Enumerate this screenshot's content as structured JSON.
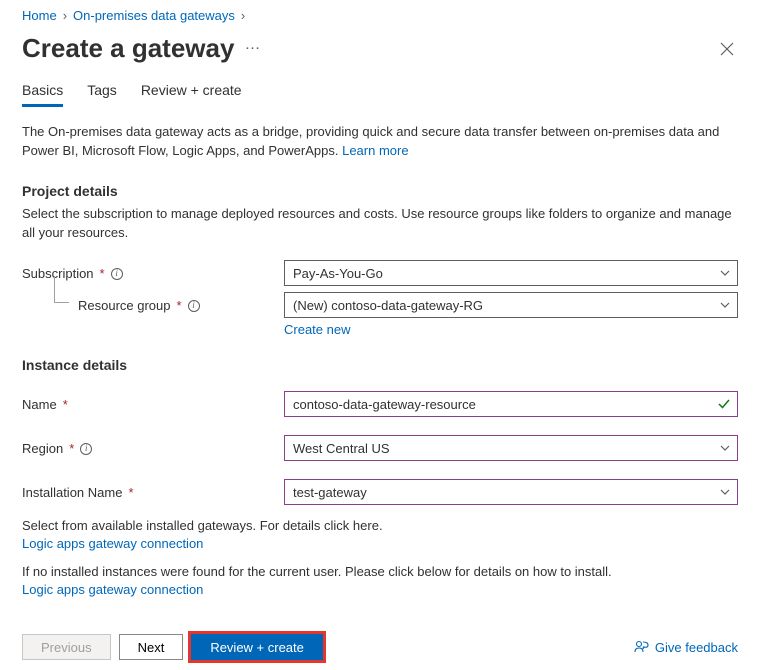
{
  "breadcrumb": {
    "home": "Home",
    "gateways": "On-premises data gateways"
  },
  "title": "Create a gateway",
  "tabs": {
    "basics": "Basics",
    "tags": "Tags",
    "review": "Review + create"
  },
  "description_text": "The On-premises data gateway acts as a bridge, providing quick and secure data transfer between on-premises data and Power BI, Microsoft Flow, Logic Apps, and PowerApps. ",
  "learn_more": "Learn more",
  "project_details": {
    "heading": "Project details",
    "desc": "Select the subscription to manage deployed resources and costs. Use resource groups like folders to organize and manage all your resources.",
    "subscription_label": "Subscription",
    "subscription_value": "Pay-As-You-Go",
    "rg_label": "Resource group",
    "rg_value": "(New) contoso-data-gateway-RG",
    "create_new": "Create new"
  },
  "instance_details": {
    "heading": "Instance details",
    "name_label": "Name",
    "name_value": "contoso-data-gateway-resource",
    "region_label": "Region",
    "region_value": "West Central US",
    "install_label": "Installation Name",
    "install_value": "test-gateway",
    "note1": "Select from available installed gateways. For details click here.",
    "link1": "Logic apps gateway connection",
    "note2": "If no installed instances were found for the current user. Please click below for details on how to install.",
    "link2": "Logic apps gateway connection"
  },
  "footer": {
    "previous": "Previous",
    "next": "Next",
    "review": "Review + create",
    "feedback": "Give feedback"
  }
}
